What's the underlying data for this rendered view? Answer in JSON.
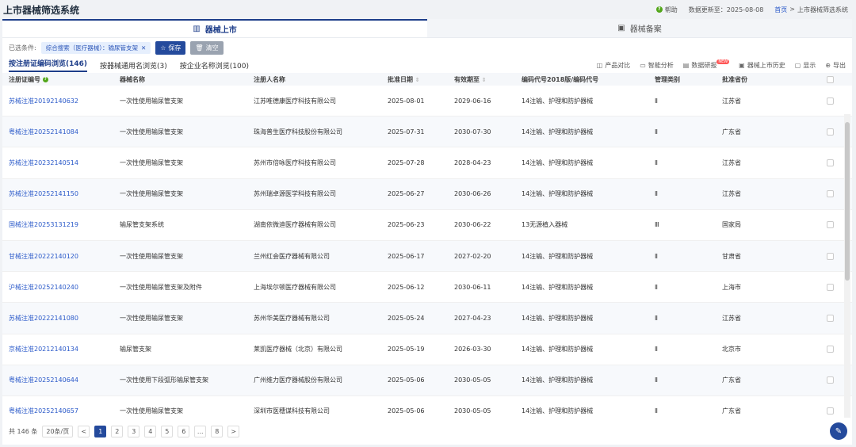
{
  "app": {
    "title": "上市器械筛选系统"
  },
  "topbar": {
    "help": "帮助",
    "updated": "数据更新至：2025-08-08",
    "home": "首页",
    "sep": ">",
    "current": "上市器械筛选系统"
  },
  "main_tabs": [
    {
      "label": "器械上市"
    },
    {
      "label": "器械备案"
    }
  ],
  "filter": {
    "label": "已选条件:",
    "chip": "综合搜索（医疗器械）：输尿管支架",
    "save": "保存",
    "clear": "清空"
  },
  "sub_tabs": [
    {
      "label": "按注册证编码浏览(146)"
    },
    {
      "label": "按器械通用名浏览(3)"
    },
    {
      "label": "按企业名称浏览(100)"
    }
  ],
  "tools": [
    {
      "label": "产品对比"
    },
    {
      "label": "智能分析"
    },
    {
      "label": "数据研报",
      "badge": "NEW"
    },
    {
      "label": "器械上市历史"
    },
    {
      "label": "显示"
    },
    {
      "label": "导出"
    }
  ],
  "columns": [
    "注册证编号",
    "器械名称",
    "注册人名称",
    "批准日期",
    "有效期至",
    "编码代号2018版/编码代号",
    "管理类别",
    "批准省份"
  ],
  "rows": [
    {
      "no": "苏械注准20192140632",
      "name": "一次性使用输尿管支架",
      "company": "江苏唯德康医疗科技有限公司",
      "approve": "2025-08-01",
      "expire": "2029-06-16",
      "code": "14注输、护理和防护器械",
      "class": "Ⅱ",
      "province": "江苏省"
    },
    {
      "no": "粤械注准20252141084",
      "name": "一次性使用输尿管支架",
      "company": "珠海普生医疗科技股份有限公司",
      "approve": "2025-07-31",
      "expire": "2030-07-30",
      "code": "14注输、护理和防护器械",
      "class": "Ⅱ",
      "province": "广东省"
    },
    {
      "no": "苏械注准20232140514",
      "name": "一次性使用输尿管支架",
      "company": "苏州市倍咏医疗科技有限公司",
      "approve": "2025-07-28",
      "expire": "2028-04-23",
      "code": "14注输、护理和防护器械",
      "class": "Ⅱ",
      "province": "江苏省"
    },
    {
      "no": "苏械注准20252141150",
      "name": "一次性使用输尿管支架",
      "company": "苏州瑞卓源医学科技有限公司",
      "approve": "2025-06-27",
      "expire": "2030-06-26",
      "code": "14注输、护理和防护器械",
      "class": "Ⅱ",
      "province": "江苏省"
    },
    {
      "no": "国械注准20253131219",
      "name": "输尿管支架系统",
      "company": "湖南依微迪医疗器械有限公司",
      "approve": "2025-06-23",
      "expire": "2030-06-22",
      "code": "13无源植入器械",
      "class": "Ⅲ",
      "province": "国家局"
    },
    {
      "no": "甘械注准20222140120",
      "name": "一次性使用输尿管支架",
      "company": "兰州红会医疗器械有限公司",
      "approve": "2025-06-17",
      "expire": "2027-02-20",
      "code": "14注输、护理和防护器械",
      "class": "Ⅱ",
      "province": "甘肃省"
    },
    {
      "no": "沪械注准20252140240",
      "name": "一次性使用输尿管支架及附件",
      "company": "上海埃尔顿医疗器械有限公司",
      "approve": "2025-06-12",
      "expire": "2030-06-11",
      "code": "14注输、护理和防护器械",
      "class": "Ⅱ",
      "province": "上海市"
    },
    {
      "no": "苏械注准20222141080",
      "name": "一次性使用输尿管支架",
      "company": "苏州华美医疗器械有限公司",
      "approve": "2025-05-24",
      "expire": "2027-04-23",
      "code": "14注输、护理和防护器械",
      "class": "Ⅱ",
      "province": "江苏省"
    },
    {
      "no": "京械注准20212140134",
      "name": "输尿管支架",
      "company": "莱凯医疗器械（北京）有限公司",
      "approve": "2025-05-19",
      "expire": "2026-03-30",
      "code": "14注输、护理和防护器械",
      "class": "Ⅱ",
      "province": "北京市"
    },
    {
      "no": "粤械注准20252140644",
      "name": "一次性使用下段弧形输尿管支架",
      "company": "广州维力医疗器械股份有限公司",
      "approve": "2025-05-06",
      "expire": "2030-05-05",
      "code": "14注输、护理和防护器械",
      "class": "Ⅱ",
      "province": "广东省"
    },
    {
      "no": "粤械注准20252140657",
      "name": "一次性使用输尿管支架",
      "company": "深圳市医穗谋科技有限公司",
      "approve": "2025-05-06",
      "expire": "2030-05-05",
      "code": "14注输、护理和防护器械",
      "class": "Ⅱ",
      "province": "广东省"
    }
  ],
  "footer": {
    "total": "共 146 条",
    "page_size": "20条/页",
    "pages": [
      "1",
      "2",
      "3",
      "4",
      "5",
      "6",
      "...",
      "8"
    ],
    "prev": "<",
    "next": ">"
  },
  "icons": {
    "help": "help-icon",
    "chart": "bar-chart-icon",
    "record": "record-icon"
  },
  "colors": {
    "brand": "#244a9c",
    "link": "#2a59c9",
    "badge": "#52a61a"
  }
}
